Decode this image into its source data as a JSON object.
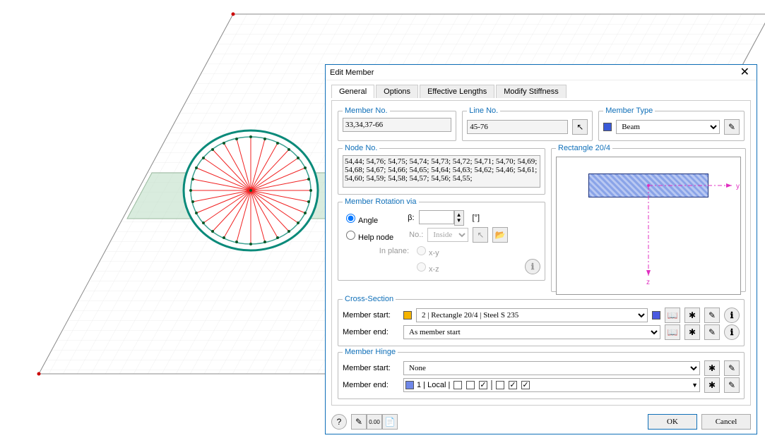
{
  "dialog": {
    "title": "Edit Member",
    "close": "✕"
  },
  "tabs": [
    "General",
    "Options",
    "Effective Lengths",
    "Modify Stiffness"
  ],
  "memberNo": {
    "legend": "Member No.",
    "value": "33,34,37-66"
  },
  "lineNo": {
    "legend": "Line No.",
    "value": "45-76"
  },
  "memberType": {
    "legend": "Member Type",
    "value": "Beam"
  },
  "nodeNo": {
    "legend": "Node No.",
    "value": "54,44; 54,76; 54,75; 54,74; 54,73; 54,72; 54,71; 54,70; 54,69; 54,68; 54,67; 54,66; 54,65; 54,64; 54,63; 54,62; 54,46; 54,61; 54,60; 54,59; 54,58; 54,57; 54,56; 54,55;"
  },
  "rotation": {
    "legend": "Member Rotation via",
    "angle": "Angle",
    "beta": "β:",
    "unit": "[°]",
    "help": "Help node",
    "noLbl": "No.:",
    "inside": "Inside",
    "inPlane": "In plane:",
    "xy": "x-y",
    "xz": "x-z"
  },
  "preview": {
    "label": "Rectangle 20/4",
    "y": "y",
    "z": "z"
  },
  "cross": {
    "legend": "Cross-Section",
    "start": "Member start:",
    "end": "Member end:",
    "startVal": " 2 | Rectangle 20/4 | Steel S 235",
    "endVal": "As member start"
  },
  "hinge": {
    "legend": "Member Hinge",
    "start": "Member start:",
    "end": "Member end:",
    "startVal": "None",
    "endVal": " 1 | Local |",
    "endColor": "#6f87e8"
  },
  "buttons": {
    "ok": "OK",
    "cancel": "Cancel"
  },
  "icons": {
    "pick": "↖",
    "lib": "📖",
    "new": "✱",
    "edit": "✎",
    "info": "ℹ",
    "help": "?",
    "comment": "✎",
    "num": "0.00",
    "oth": "📄"
  }
}
